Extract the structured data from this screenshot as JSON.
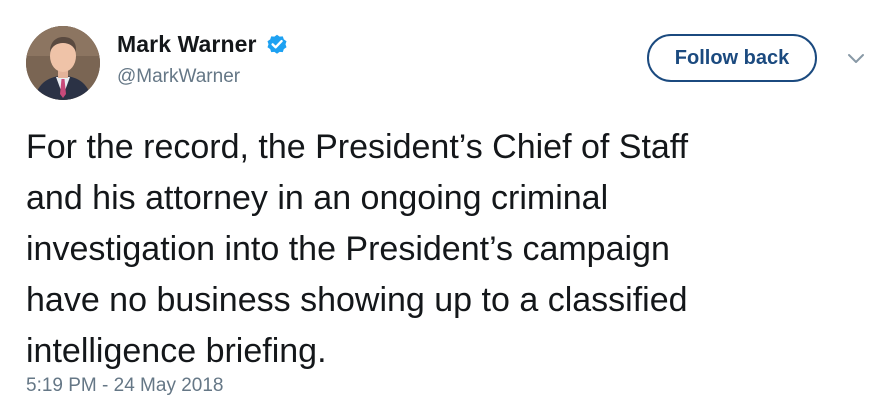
{
  "author": {
    "display_name": "Mark Warner",
    "handle": "@MarkWarner",
    "verified_icon": "verified-badge-icon",
    "verified_color": "#1da1f2"
  },
  "follow_button": {
    "label": "Follow back",
    "color": "#1b4a7f"
  },
  "menu": {
    "icon": "chevron-down-icon"
  },
  "tweet": {
    "text": "For the record, the President’s Chief of Staff\nand his attorney in an ongoing criminal\ninvestigation into the President’s campaign\nhave no business showing up to a classified\nintelligence briefing.",
    "timestamp": "5:19 PM - 24 May 2018"
  },
  "colors": {
    "text": "#14171a",
    "secondary": "#657786"
  }
}
